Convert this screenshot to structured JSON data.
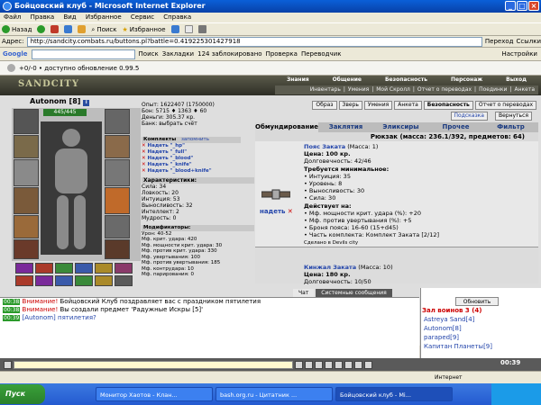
{
  "window": {
    "title": "Бойцовский клуб - Microsoft Internet Explorer"
  },
  "menu": [
    "Файл",
    "Правка",
    "Вид",
    "Избранное",
    "Сервис",
    "Справка"
  ],
  "toolbar": {
    "back": "Назад",
    "search": "Поиск",
    "favorites": "Избранное"
  },
  "address": {
    "label": "Адрес:",
    "url": "http://sandcity.combats.ru/buttons.pl?battle=0.419225301427918",
    "go": "Переход",
    "links": "Ссылки"
  },
  "google": {
    "search_btn": "Поиск",
    "bookmarks": "Закладки",
    "blocked": "124 заблокировано",
    "check": "Проверка",
    "translate": "Переводчик",
    "settings": "Настройки"
  },
  "update": {
    "text": "+0/-0 • доступно обновление 0.99.5"
  },
  "game": {
    "logo": "SANDCITY",
    "topnav": [
      "Знания",
      "Общение",
      "Безопасность",
      "Персонаж",
      "Выход"
    ],
    "subnav": [
      "Инвентарь",
      "Умения",
      "Мой Скролл",
      "Отчет о переводах",
      "Поединки",
      "Анкета"
    ],
    "player": {
      "name": "Autonom",
      "level": "[8]",
      "hp": "445/445"
    },
    "stats": {
      "exp": "Опыт: 1622407 (1750000)",
      "wins": "Бон: 5715 ♦ 1363 ♦ 60",
      "money": "Деньги: 305.37 кр.",
      "bank": "Банк: выбрать счёт"
    },
    "sets": {
      "header": "Комплекты",
      "remember": "запомнить",
      "items": [
        "Надеть \"_hp\"",
        "Надеть \"_full\"",
        "Надеть \"_blood\"",
        "Надеть \"_knife\"",
        "Надеть \"_blood+knife\""
      ]
    },
    "chars": {
      "header": "Характеристики:",
      "items": [
        "Сила: 34",
        "Ловкость: 20",
        "Интуиция: 53",
        "Выносливость: 32",
        "Интеллект: 2",
        "Мудрость: 0"
      ]
    },
    "mods": {
      "header": "Модификаторы:",
      "items": [
        "Урон: 40-52",
        "Мф. крит. удара: 420",
        "Мф. мощности крит. удара: 30",
        "Мф. против крит. удара: 330",
        "Мф. увертывания: 100",
        "Мф. против увертывания: 185",
        "Мф. контрудара: 10",
        "Мф. парирования: 0"
      ]
    },
    "actions": [
      "Образ",
      "Зверь",
      "Умения",
      "Анкета",
      "Безопасность",
      "Отчет о переводах"
    ],
    "subactions": [
      "Подсказка",
      "Вернуться"
    ],
    "tabs": [
      "Обмундирование",
      "Заклятия",
      "Эликсиры",
      "Прочее",
      "Фильтр"
    ],
    "inv_header": "Рюкзак (масса: 236.1/392, предметов: 64)",
    "item1": {
      "put": "надеть",
      "name": "Пояс Заката",
      "mass": "(Масса: 1)",
      "price": "Цена: 100 кр.",
      "durability": "Долговечность: 42/46",
      "req_title": "Требуется минимальное:",
      "req": [
        "• Интуиция: 35",
        "• Уровень: 8",
        "• Выносливость: 30",
        "• Сила: 30"
      ],
      "acts_title": "Действует на:",
      "acts": [
        "• Мф. мощности крит. удара (%): +20",
        "• Мф. против увертывания (%): +5",
        "• Броня пояса: 16-60 (15+d45)",
        "• Часть комплекта: Комплект Заката [2/12]"
      ],
      "made": "Сделано в Devils city"
    },
    "item2": {
      "name": "Кинжал Заката",
      "mass": "(Масса: 10)",
      "price": "Цена: 180 кр.",
      "durability": "Долговечность: 10/50"
    }
  },
  "chat": {
    "tabs": [
      "Чат",
      "Системные сообщения"
    ],
    "lines": [
      {
        "time": "00:38",
        "tag": "Внимание!",
        "text": " Бойцовский Клуб поздравляет вас с праздником пятилетия"
      },
      {
        "time": "00:38",
        "tag": "Внимание!",
        "text": " Вы создали предмет 'Радужные Искры [5]'"
      },
      {
        "time": "00:39",
        "tag": "[Autonom]",
        "text": " пятилетия?"
      }
    ]
  },
  "online": {
    "refresh": "Обновить",
    "title": "Зал воинов 3 (4)",
    "users": [
      "Astreya Sand[4]",
      "Autonom[8]",
      "paraped[9]",
      "Капитан Планеты[9]"
    ]
  },
  "clock": "00:39",
  "ie_status": {
    "zone": "Интернет"
  },
  "taskbar": {
    "start": "Пуск",
    "tasks": [
      "Монитор Хаотов - Клан...",
      "bash.org.ru - Цитатник ...",
      "Бойцовский клуб - Mi..."
    ]
  },
  "colors": {
    "accent": "#2244aa",
    "warning": "#cc0000",
    "timestamp_bg": "#2a9a2a"
  }
}
